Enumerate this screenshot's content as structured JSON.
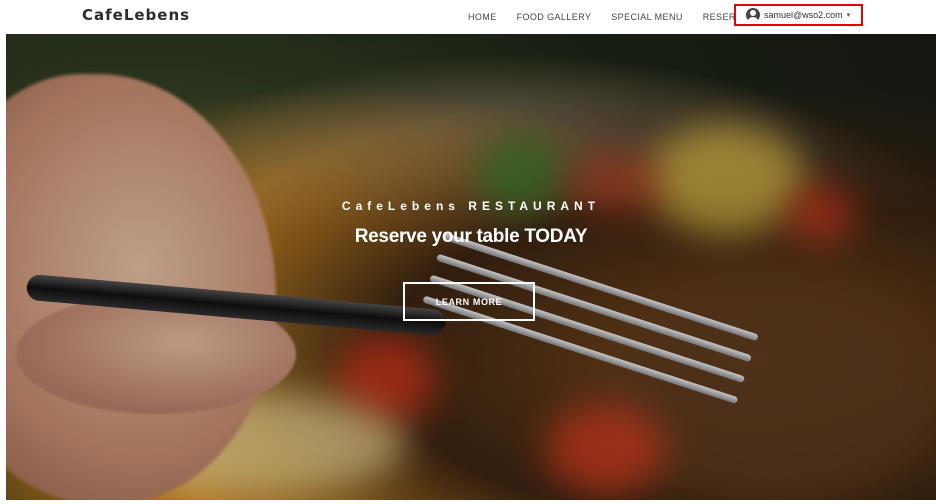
{
  "navbar": {
    "brand": "CafeLebens",
    "links": [
      {
        "label": "HOME"
      },
      {
        "label": "FOOD GALLERY"
      },
      {
        "label": "SPECIAL MENU"
      },
      {
        "label": "RESERVE"
      }
    ],
    "user": {
      "icon": "user-avatar-icon",
      "email": "samuel@wso2.com",
      "caret": "▾"
    },
    "highlight_color": "#e8000b"
  },
  "hero": {
    "subtitle": "CafeLebens RESTAURANT",
    "title": "Reserve your table TODAY",
    "cta_label": "LEARN MORE"
  }
}
